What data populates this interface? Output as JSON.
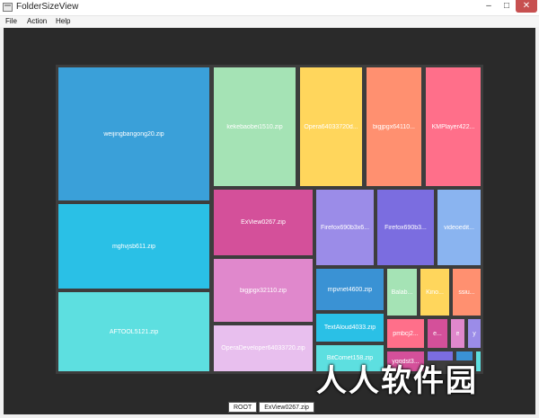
{
  "window": {
    "title": "FolderSizeView"
  },
  "window_controls": {
    "minimize": "–",
    "maximize": "□",
    "close": "✕"
  },
  "menu": {
    "items": [
      "File",
      "Action",
      "Help"
    ]
  },
  "treemap": {
    "tiles": [
      {
        "label": "weijingbangong20.zip",
        "color": "#3aa0d9"
      },
      {
        "label": "kekebaobei1510.zip",
        "color": "#a5e3b5"
      },
      {
        "label": "Opera64033720d...",
        "color": "#ffd65c"
      },
      {
        "label": "bigjpgx64110...",
        "color": "#ff9070"
      },
      {
        "label": "KMPlayer422...",
        "color": "#ff6f8a"
      },
      {
        "label": "mghvjsb611.zip",
        "color": "#2ac0e6"
      },
      {
        "label": "ExView0267.zip",
        "color": "#d4509a"
      },
      {
        "label": "Firefox690b3x6...",
        "color": "#9b8ce8"
      },
      {
        "label": "Firefox690b3...",
        "color": "#7b6de0"
      },
      {
        "label": "videoedit...",
        "color": "#8ab4f0"
      },
      {
        "label": "AFTOOL5121.zip",
        "color": "#5ddfe0"
      },
      {
        "label": "bigjpgx32110.zip",
        "color": "#e088cc"
      },
      {
        "label": "mpvnet4600.zip",
        "color": "#3a92d4"
      },
      {
        "label": "Balab...",
        "color": "#a5e3b5"
      },
      {
        "label": "Kino...",
        "color": "#ffd65c"
      },
      {
        "label": "ssiu...",
        "color": "#ff9070"
      },
      {
        "label": "OperaDeveloper64033720.zip",
        "color": "#e8bfee"
      },
      {
        "label": "TextAloud4033.zip",
        "color": "#2ac0e6"
      },
      {
        "label": "pmbcj2...",
        "color": "#ff6f8a"
      },
      {
        "label": "e...",
        "color": "#d4509a"
      },
      {
        "label": "e",
        "color": "#e088cc"
      },
      {
        "label": "y",
        "color": "#9b8ce8"
      },
      {
        "label": "BitComet158.zip",
        "color": "#5ddfe0"
      },
      {
        "label": "yqqdst3...",
        "color": "#d4509a"
      },
      {
        "label": "",
        "color": "#7b6de0"
      },
      {
        "label": "",
        "color": "#3a92d4"
      },
      {
        "label": "",
        "color": "#5ddfe0"
      }
    ]
  },
  "breadcrumb": [
    "ROOT",
    "ExView0267.zip"
  ],
  "watermark": "人人软件园"
}
